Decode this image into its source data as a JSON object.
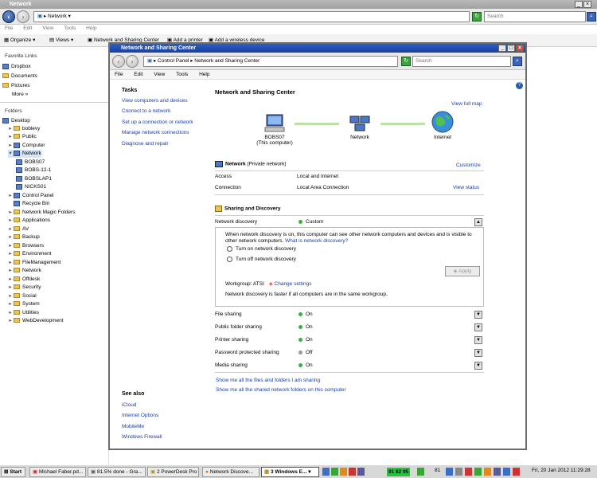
{
  "bg_window": {
    "title": "Network",
    "address": "Network",
    "search_placeholder": "Search",
    "menu": [
      "File",
      "Edit",
      "View",
      "Tools",
      "Help"
    ],
    "toolbar": [
      "Organize",
      "Views",
      "Network and Sharing Center",
      "Add a printer",
      "Add a wireless device"
    ],
    "favorite_links_header": "Favorite Links",
    "favorites": [
      "Dropbox",
      "Documents",
      "Pictures"
    ],
    "more_label": "More",
    "folders_header": "Folders",
    "tree": [
      "Desktop",
      "boblevy",
      "Public",
      "Computer",
      "Network",
      "BOBS07",
      "BOBS-12-1",
      "BOBSLAP1",
      "NICKS01",
      "Control Panel",
      "Recycle Bin",
      "Network Magic Folders",
      "Applications",
      "AV",
      "Backup",
      "Browsers",
      "Environment",
      "FileManagement",
      "Network",
      "Offdesk",
      "Security",
      "Social",
      "System",
      "Utilities",
      "WebDevelopment"
    ]
  },
  "nsc": {
    "title": "Network and Sharing Center",
    "breadcrumb_root": "Control Panel",
    "breadcrumb_current": "Network and Sharing Center",
    "search_placeholder": "Search",
    "menu": [
      "File",
      "Edit",
      "View",
      "Tools",
      "Help"
    ],
    "tasks_header": "Tasks",
    "tasks": [
      "View computers and devices",
      "Connect to a network",
      "Set up a connection or network",
      "Manage network connections",
      "Diagnose and repair"
    ],
    "see_also_header": "See also",
    "see_also": [
      "iCloud",
      "Internet Options",
      "MobileMe",
      "Windows Firewall"
    ],
    "heading": "Network and Sharing Center",
    "view_full_map": "View full map",
    "map": {
      "computer_name": "BOBS07",
      "computer_sub": "(This computer)",
      "network": "Network",
      "internet": "Internet"
    },
    "network_name": "Network",
    "network_type": "(Private network)",
    "customize": "Customize",
    "access_label": "Access",
    "access_value": "Local and Internet",
    "connection_label": "Connection",
    "connection_value": "Local Area Connection",
    "view_status": "View status",
    "sharing_header": "Sharing and Discovery",
    "discovery_label": "Network discovery",
    "discovery_value": "Custom",
    "discovery_desc": "When network discovery is on, this computer can see other network computers and devices and is visible to other network computers.",
    "what_is_link": "What is network discovery?",
    "radio_on": "Turn on network discovery",
    "radio_off": "Turn off network discovery",
    "apply": "Apply",
    "workgroup": "Workgroup: ATSI",
    "change_settings": "Change settings",
    "workgroup_note": "Network discovery is faster if all computers are in the same workgroup.",
    "sharing_rows": [
      {
        "label": "File sharing",
        "value": "On"
      },
      {
        "label": "Public folder sharing",
        "value": "On"
      },
      {
        "label": "Printer sharing",
        "value": "On"
      },
      {
        "label": "Password protected sharing",
        "value": "Off"
      },
      {
        "label": "Media sharing",
        "value": "On"
      }
    ],
    "show_files_link": "Show me all the files and folders I am sharing",
    "show_folders_link": "Show me all the shared network folders on this computer"
  },
  "taskbar": {
    "start": "Start",
    "items": [
      "Michael Faber.pd...",
      "81.5% done - Gra...",
      "2 PowerDesk Pro",
      "Network Discove...",
      "3 Windows E...",
      "91 82 95",
      "81"
    ],
    "clock": "Fri, 20 Jan 2012  11:29:28"
  }
}
